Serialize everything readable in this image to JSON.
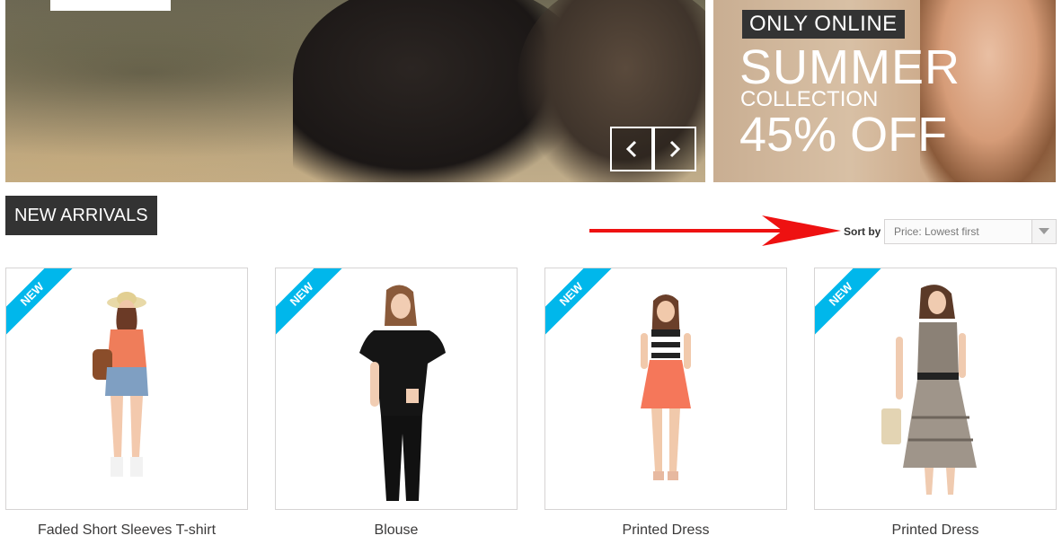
{
  "promo": {
    "tag": "ONLY ONLINE",
    "line1": "SUMMER",
    "line2": "COLLECTION",
    "line3": "45% OFF"
  },
  "slider": {
    "prev_icon": "chevron-left-icon",
    "next_icon": "chevron-right-icon"
  },
  "section": {
    "title": "NEW ARRIVALS"
  },
  "sort": {
    "label": "Sort by",
    "selected": "Price: Lowest first",
    "arrow_color": "#ee1111"
  },
  "products": [
    {
      "name": "Faded Short Sleeves T-shirt",
      "badge": "NEW"
    },
    {
      "name": "Blouse",
      "badge": "NEW"
    },
    {
      "name": "Printed Dress",
      "badge": "NEW"
    },
    {
      "name": "Printed Dress",
      "badge": "NEW"
    }
  ],
  "colors": {
    "badge": "#00b7eb",
    "dark_header": "#333333"
  }
}
